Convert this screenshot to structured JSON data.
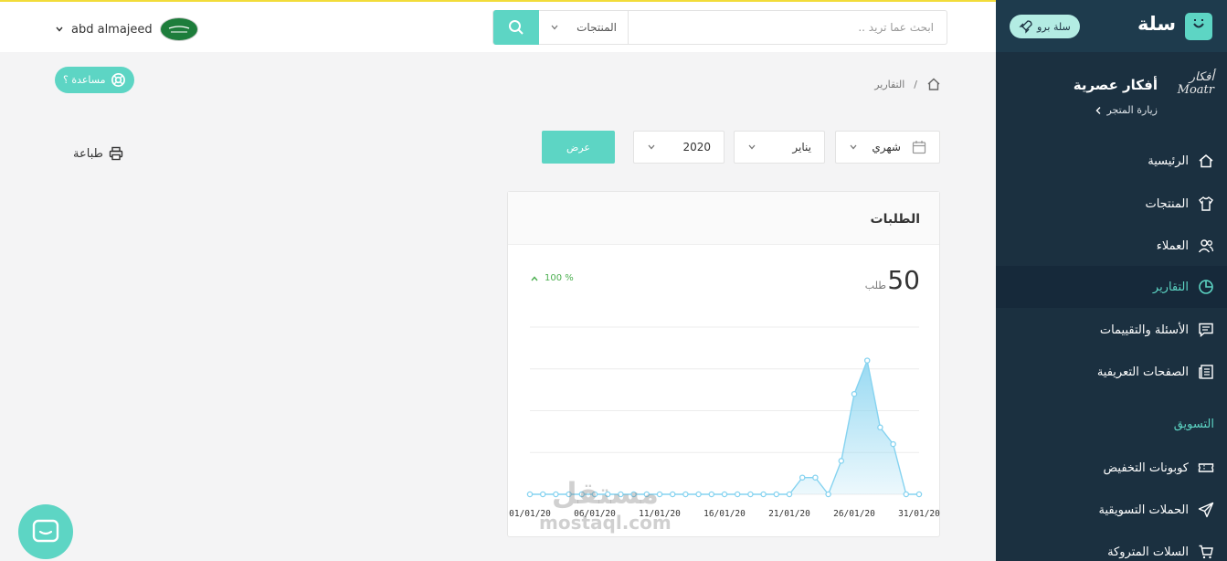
{
  "sidebar": {
    "brand": "سلة",
    "pro_badge": "سلة برو",
    "store_logo_text": "أفكار",
    "store_name": "أفكار عصرية",
    "visit_store": "زيارة المتجر",
    "items": [
      {
        "label": "الرئيسية",
        "icon": "home-icon"
      },
      {
        "label": "المنتجات",
        "icon": "shirt-icon"
      },
      {
        "label": "العملاء",
        "icon": "users-icon"
      },
      {
        "label": "التقارير",
        "icon": "pie-chart-icon",
        "active": true
      },
      {
        "label": "الأسئلة والتقييمات",
        "icon": "comment-icon"
      },
      {
        "label": "الصفحات التعريفية",
        "icon": "newspaper-icon"
      }
    ],
    "section_marketing": "التسويق",
    "marketing_items": [
      {
        "label": "كوبونات التخفيض",
        "icon": "ticket-icon"
      },
      {
        "label": "الحملات التسويقية",
        "icon": "send-icon"
      },
      {
        "label": "السلات المتروكة",
        "icon": "cart-icon"
      }
    ]
  },
  "header": {
    "search_placeholder": "ابحث عما تريد ..",
    "search_scope": "المنتجات",
    "user_name": "abd almajeed"
  },
  "help_label": "مساعدة ؟",
  "breadcrumb": {
    "current": "التقارير",
    "separator": "/"
  },
  "print_label": "طباعة",
  "filters": {
    "period": "شهري",
    "month": "يناير",
    "year": "2020",
    "show_label": "عرض"
  },
  "orders_card": {
    "title": "الطلبات",
    "total": "50",
    "unit": "طلب",
    "change": "100 %"
  },
  "chart_data": {
    "type": "area",
    "x": [
      "01/01/20",
      "02/01/20",
      "03/01/20",
      "04/01/20",
      "05/01/20",
      "06/01/20",
      "07/01/20",
      "08/01/20",
      "09/01/20",
      "10/01/20",
      "11/01/20",
      "12/01/20",
      "13/01/20",
      "14/01/20",
      "15/01/20",
      "16/01/20",
      "17/01/20",
      "18/01/20",
      "19/01/20",
      "20/01/20",
      "21/01/20",
      "22/01/20",
      "23/01/20",
      "24/01/20",
      "25/01/20",
      "26/01/20",
      "27/01/20",
      "28/01/20",
      "29/01/20",
      "30/01/20",
      "31/01/20"
    ],
    "tick_labels": [
      "01/01/20",
      "06/01/20",
      "11/01/20",
      "16/01/20",
      "21/01/20",
      "26/01/20",
      "31/01/20"
    ],
    "values": [
      0,
      0,
      0,
      0,
      0,
      0,
      0,
      0,
      0,
      0,
      0,
      0,
      0,
      0,
      0,
      0,
      0,
      0,
      0,
      0,
      0,
      2,
      2,
      0,
      4,
      12,
      16,
      8,
      6,
      0,
      0
    ],
    "ylim": [
      0,
      20
    ],
    "grid": true,
    "color": "#86d3f0"
  },
  "watermark": {
    "line1": "مستقل",
    "line2": "mostaql.com"
  },
  "colors": {
    "accent": "#5dd5c4",
    "sidebar": "#1b3040",
    "line": "#86d3f0"
  }
}
